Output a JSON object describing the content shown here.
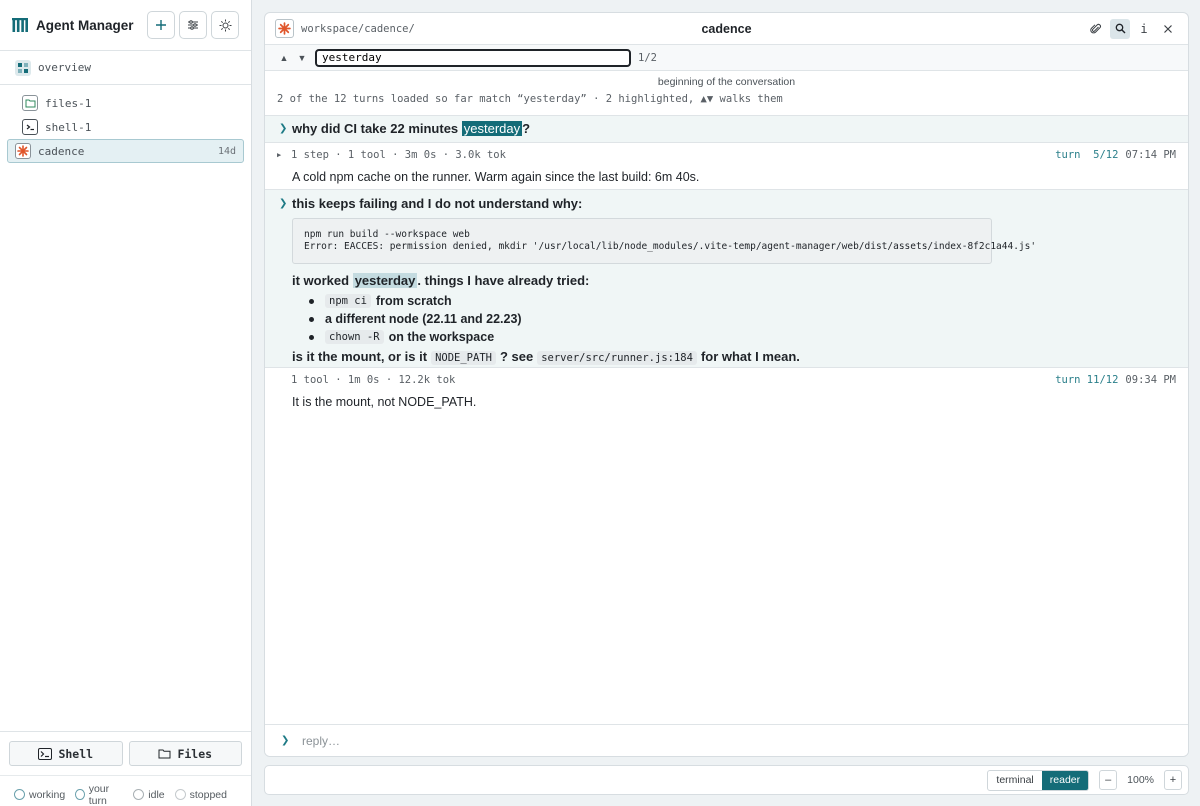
{
  "app": {
    "title": "Agent Manager"
  },
  "sidebar": {
    "overview_label": "overview",
    "sessions": [
      {
        "label": "files-1",
        "age": "",
        "icon": "folder-icon"
      },
      {
        "label": "shell-1",
        "age": "",
        "icon": "terminal-icon"
      },
      {
        "label": "cadence",
        "age": "14d",
        "icon": "asterisk-icon",
        "selected": true
      }
    ],
    "buttons": {
      "shell": "Shell",
      "files": "Files"
    },
    "legend": [
      "working",
      "your turn",
      "idle",
      "stopped"
    ]
  },
  "session": {
    "path": "workspace/cadence/",
    "title": "cadence"
  },
  "search": {
    "query": "yesterday",
    "count": "1/2"
  },
  "conversation": {
    "beginning": "beginning of the conversation",
    "match_info": "2 of the 12 turns loaded so far match “yesterday” · 2 highlighted, ▲▼ walks them",
    "turn1": {
      "user_pre": "why did CI take 22 minutes ",
      "user_hl": "yesterday",
      "user_post": "?",
      "meta": "1 step · 1 tool · 3m 0s · 3.0k tok",
      "turn": "turn  5/12",
      "time": "07:14 PM",
      "answer": "A cold npm cache on the runner. Warm again since the last build: 6m 40s."
    },
    "turn2": {
      "user_line1": "this keeps failing and I do not understand why:",
      "code": "npm run build --workspace web\nError: EACCES: permission denied, mkdir '/usr/local/lib/node_modules/.vite-temp/agent-manager/web/dist/assets/index-8f2c1a44.js'",
      "worked_pre": "it worked ",
      "worked_hl": "yesterday",
      "worked_post": ". things I have already tried:",
      "bullets": [
        {
          "code": "npm ci",
          "text": "from scratch"
        },
        {
          "code": "",
          "text": "a different node (22.11 and 22.23)"
        },
        {
          "code": "chown -R",
          "text": "on the workspace"
        }
      ],
      "q_pre": "is it the mount, or is it",
      "q_code1": "NODE_PATH",
      "q_mid": "? see",
      "q_code2": "server/src/runner.js:184",
      "q_post": "for what I mean.",
      "meta": "1 tool · 1m 0s · 12.2k tok",
      "turn": "turn 11/12",
      "time": "09:34 PM",
      "answer": "It is the mount, not NODE_PATH."
    }
  },
  "reply": {
    "placeholder": "reply…"
  },
  "bottom": {
    "modes": [
      "terminal",
      "reader"
    ],
    "active_mode": "reader",
    "zoom": "100%",
    "zoom_out": "–",
    "zoom_in": "+"
  },
  "colors": {
    "accent": "#146c78",
    "highlight": "#c4dbe0",
    "user_bg": "#f0f6f6"
  }
}
